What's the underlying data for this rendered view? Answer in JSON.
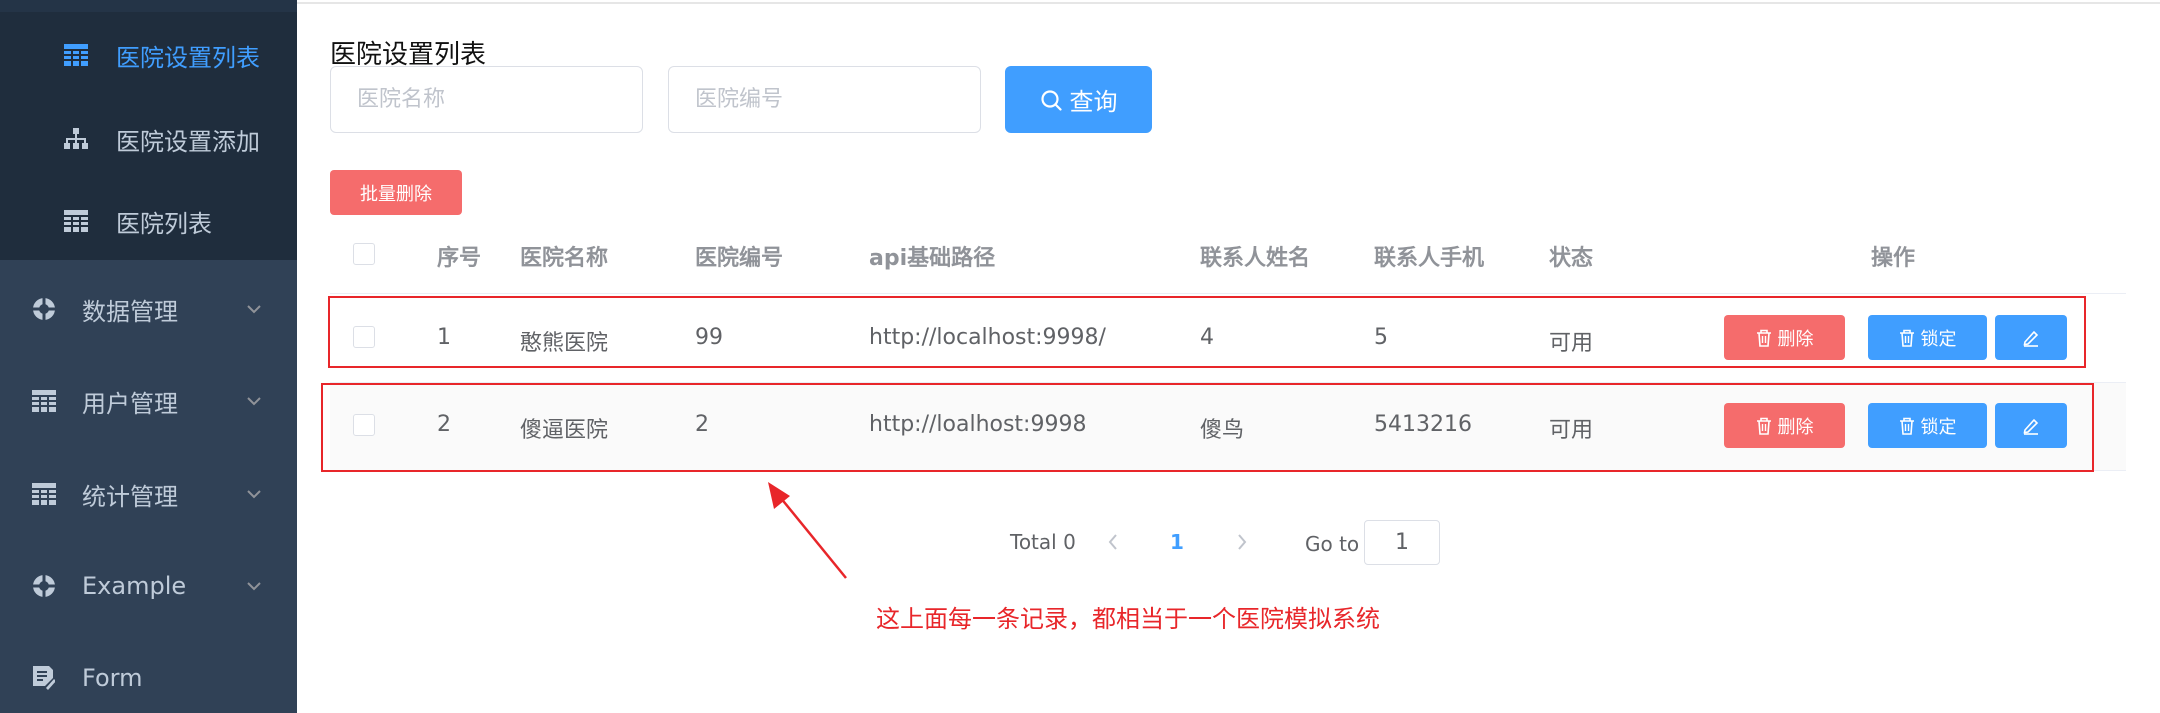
{
  "sidebar": {
    "submenu": [
      {
        "label": "医院设置列表",
        "icon": "table-icon",
        "active": true
      },
      {
        "label": "医院设置添加",
        "icon": "tree-icon",
        "active": false
      },
      {
        "label": "医院列表",
        "icon": "table-icon",
        "active": false
      }
    ],
    "menus": [
      {
        "label": "数据管理",
        "icon": "example-icon"
      },
      {
        "label": "用户管理",
        "icon": "table-icon"
      },
      {
        "label": "统计管理",
        "icon": "table-icon"
      },
      {
        "label": "Example",
        "icon": "example-icon"
      },
      {
        "label": "Form",
        "icon": "form-icon"
      }
    ]
  },
  "main": {
    "title": "医院设置列表",
    "search": {
      "hosname_placeholder": "医院名称",
      "hoscode_placeholder": "医院编号",
      "query_label": "查询"
    },
    "batch_delete_label": "批量删除"
  },
  "table": {
    "headers": [
      "序号",
      "医院名称",
      "医院编号",
      "api基础路径",
      "联系人姓名",
      "联系人手机",
      "状态",
      "操作"
    ],
    "rows": [
      {
        "index": "1",
        "hosname": "憨熊医院",
        "hoscode": "99",
        "api_url": "http://localhost:9998/",
        "contacts_name": "4",
        "contacts_phone": "5",
        "status": "可用"
      },
      {
        "index": "2",
        "hosname": "傻逼医院",
        "hoscode": "2",
        "api_url": "http://loalhost:9998",
        "contacts_name": "傻鸟",
        "contacts_phone": "5413216",
        "status": "可用"
      }
    ],
    "actions": {
      "delete_label": "删除",
      "lock_label": "锁定"
    }
  },
  "pagination": {
    "total_label": "Total 0",
    "current_page": "1",
    "goto_label": "Go to",
    "goto_value": "1"
  },
  "annotation": {
    "text": "这上面每一条记录，都相当于一个医院模拟系统",
    "color": "#e8262a"
  },
  "colors": {
    "sidebar_bg": "#304156",
    "submenu_bg": "#1f2d3d",
    "primary": "#409eff",
    "danger": "#f56c6c"
  }
}
